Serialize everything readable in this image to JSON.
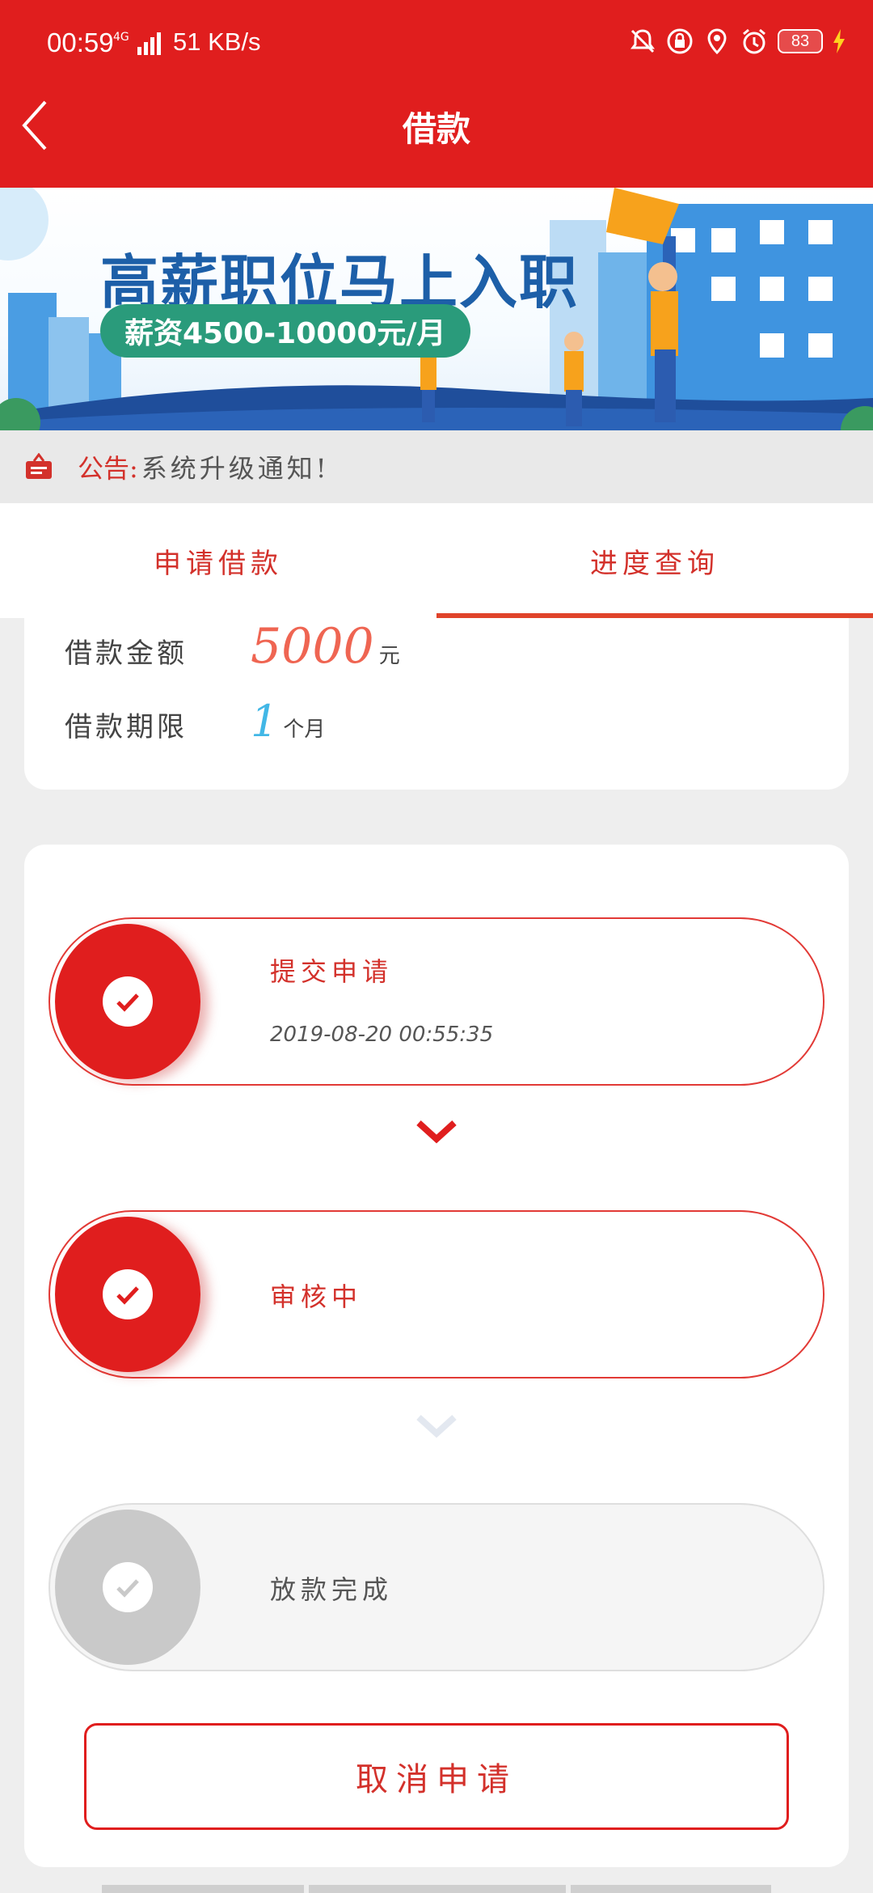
{
  "status_bar": {
    "time": "00:59",
    "network": "4G",
    "speed": "51 KB/s",
    "battery": "83"
  },
  "nav": {
    "title": "借款"
  },
  "banner": {
    "headline": "高薪职位马上入职",
    "salary": "薪资4500-10000元/月"
  },
  "notice": {
    "label": "公告:",
    "text": "系统升级通知!"
  },
  "tabs": [
    {
      "label": "申请借款",
      "active": false
    },
    {
      "label": "进度查询",
      "active": true
    }
  ],
  "loan_info": {
    "amount_label": "借款金额",
    "amount_value": "5000",
    "amount_unit": "元",
    "term_label": "借款期限",
    "term_value": "1",
    "term_unit": "个月"
  },
  "steps": [
    {
      "title": "提交申请",
      "time": "2019-08-20  00:55:35",
      "done": true
    },
    {
      "title": "审核中",
      "time": "",
      "done": true
    },
    {
      "title": "放款完成",
      "time": "",
      "done": false
    }
  ],
  "cancel_button": "取消申请",
  "colors": {
    "primary": "#e01e1e",
    "amount": "#ef6552",
    "term": "#42b7e6",
    "inactive": "#c9c9c9"
  }
}
